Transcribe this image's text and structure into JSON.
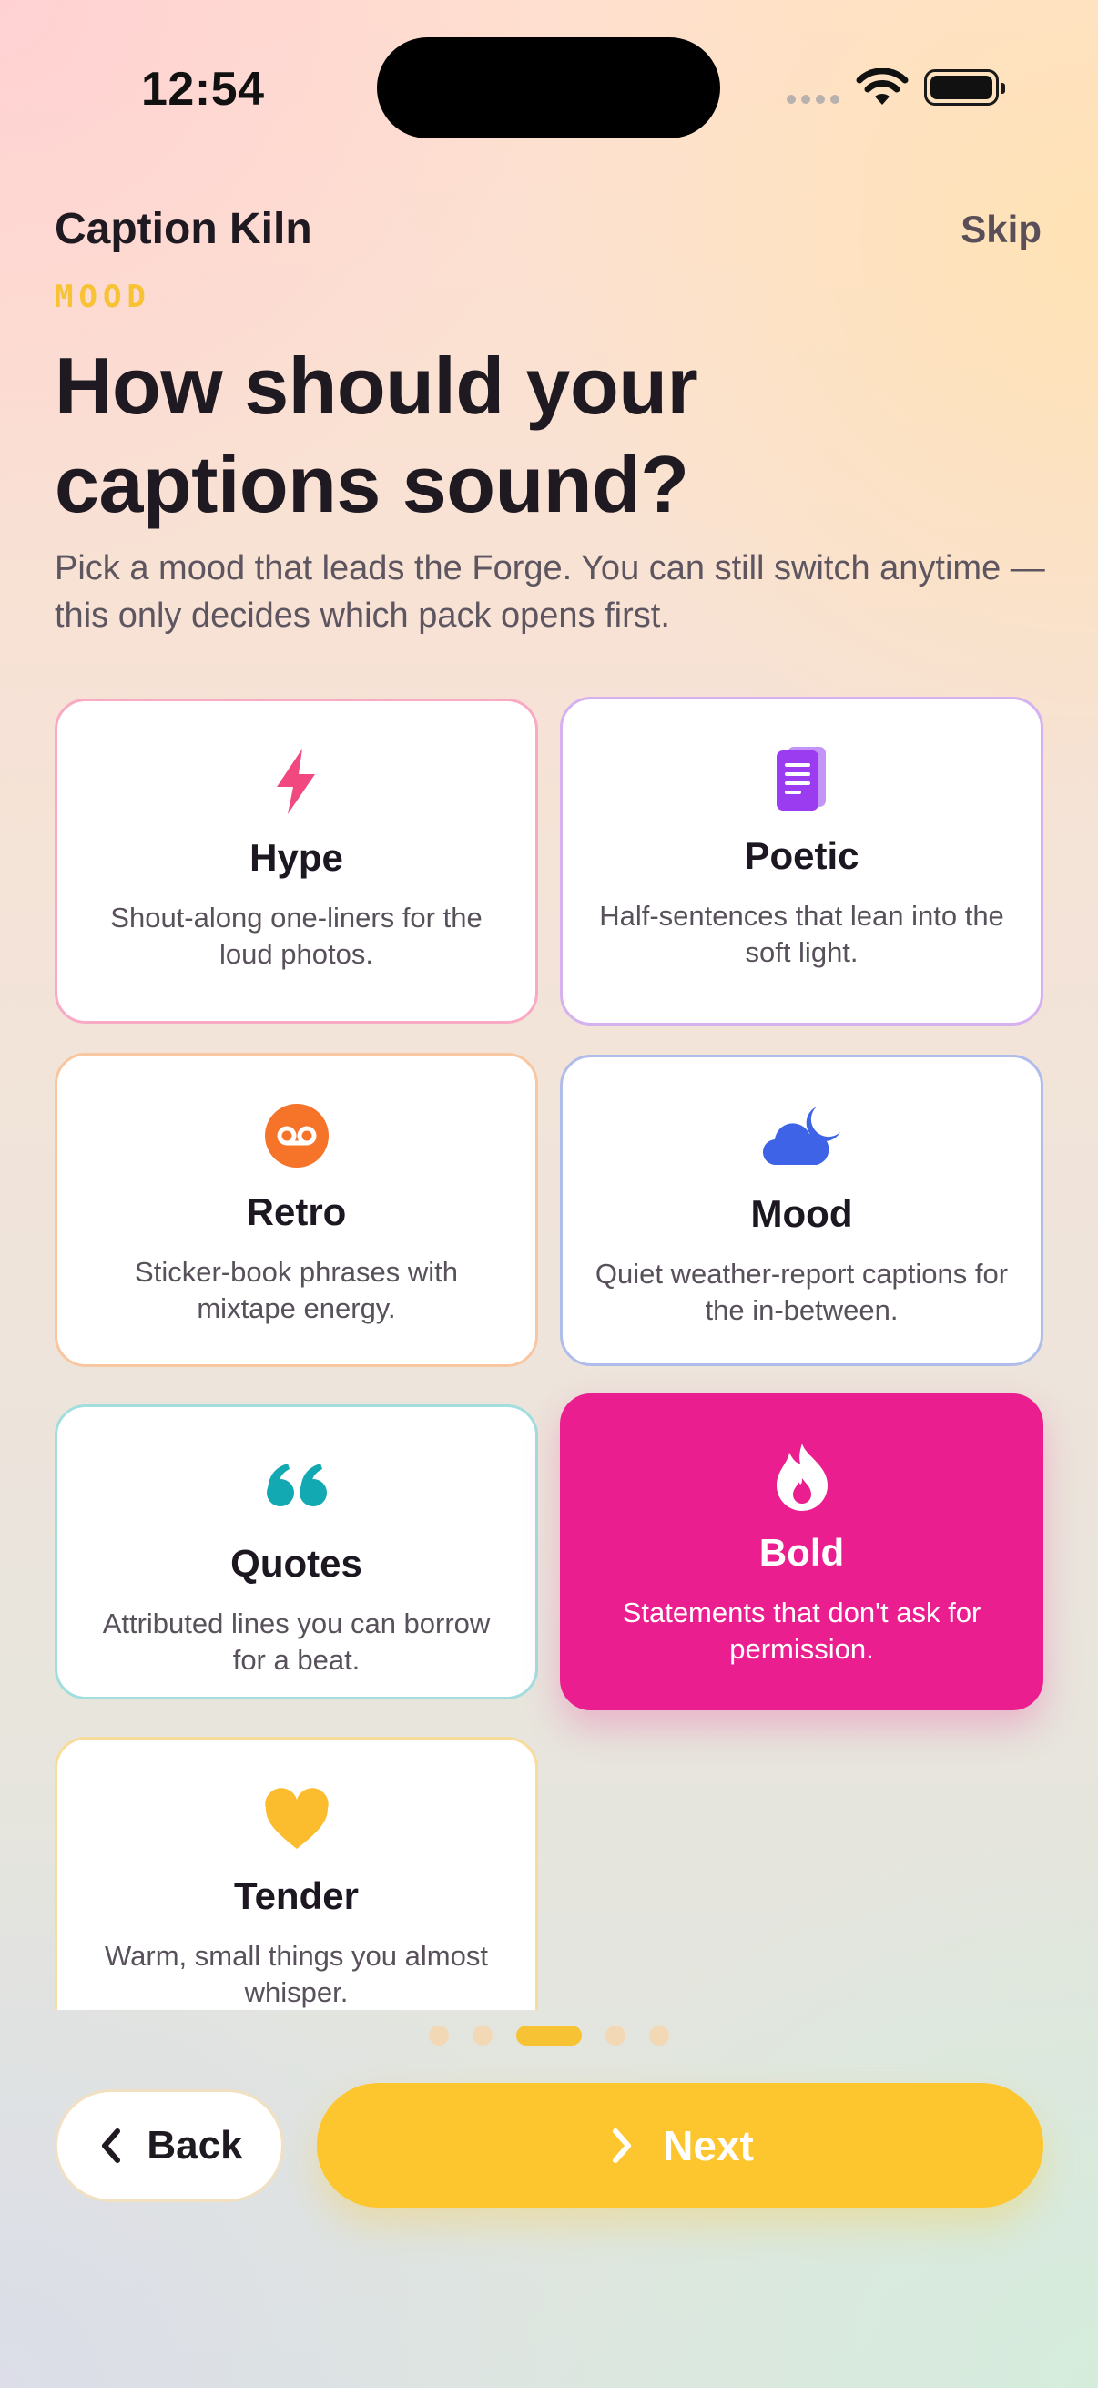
{
  "status_bar": {
    "time": "12:54"
  },
  "header": {
    "app_name": "Caption Kiln",
    "skip_label": "Skip"
  },
  "step": {
    "eyebrow": "MOOD",
    "headline": "How should your captions sound?",
    "subtext": "Pick a mood that leads the Forge. You can still switch anytime — this only decides which pack opens first."
  },
  "moods": [
    {
      "icon": "lightning-icon",
      "title": "Hype",
      "desc": "Shout-along one-liners for the loud photos.",
      "accent": "#f0487f"
    },
    {
      "icon": "document-icon",
      "title": "Poetic",
      "desc": "Half-sentences that lean into the soft light.",
      "accent": "#9b3cf0"
    },
    {
      "icon": "voicemail-icon",
      "title": "Retro",
      "desc": "Sticker-book phrases with mixtape energy.",
      "accent": "#f5742a"
    },
    {
      "icon": "cloud-moon-icon",
      "title": "Mood",
      "desc": "Quiet weather-report captions for the in-between.",
      "accent": "#3e63e6"
    },
    {
      "icon": "quote-icon",
      "title": "Quotes",
      "desc": "Attributed lines you can borrow for a beat.",
      "accent": "#13a9b3"
    },
    {
      "icon": "fire-icon",
      "title": "Bold",
      "desc": "Statements that don't ask for permission.",
      "accent": "#ea1e8f",
      "selected": true
    },
    {
      "icon": "heart-icon",
      "title": "Tender",
      "desc": "Warm, small things you almost whisper.",
      "accent": "#fbbd2e"
    }
  ],
  "pager": {
    "total": 5,
    "current": 3
  },
  "footer": {
    "back_label": "Back",
    "next_label": "Next"
  }
}
